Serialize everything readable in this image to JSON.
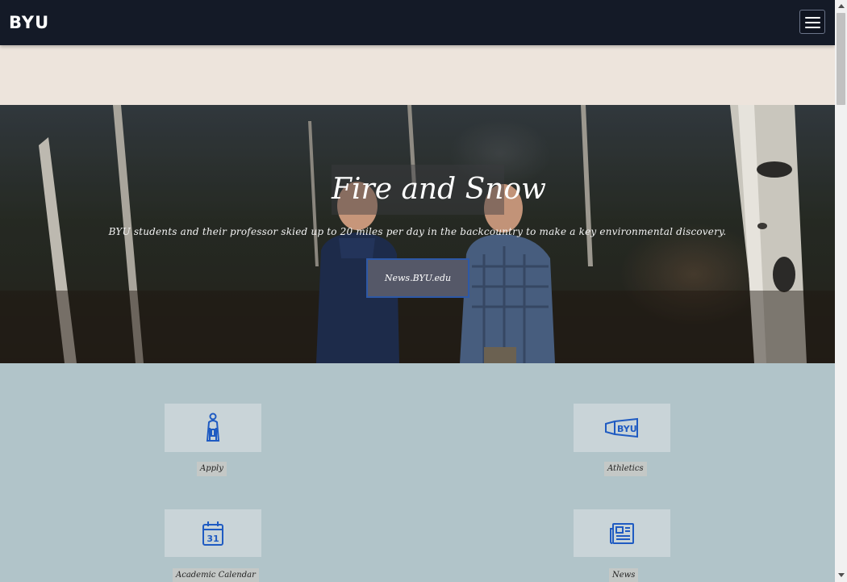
{
  "header": {
    "logo_text": "BYU",
    "menu_icon": "hamburger-menu-icon"
  },
  "hero": {
    "title": "Fire and Snow",
    "subtitle": "BYU students and their professor skied up to 20 miles per day in the backcountry to make a key environmental discovery.",
    "cta_label": "News.BYU.edu"
  },
  "quick_links": [
    {
      "label": "Apply",
      "icon": "graduate-icon"
    },
    {
      "label": "Athletics",
      "icon": "byu-megaphone-icon"
    },
    {
      "label": "Academic Calendar",
      "icon": "calendar-icon",
      "icon_text": "31"
    },
    {
      "label": "News",
      "icon": "newspaper-icon"
    }
  ],
  "colors": {
    "header_bg": "#141a27",
    "band_bg": "#ede4dc",
    "page_bg": "#b1c4c9",
    "tile_bg": "#c9d4d8",
    "icon_blue": "#1f5bc2",
    "cta_border": "#2d58a6"
  }
}
